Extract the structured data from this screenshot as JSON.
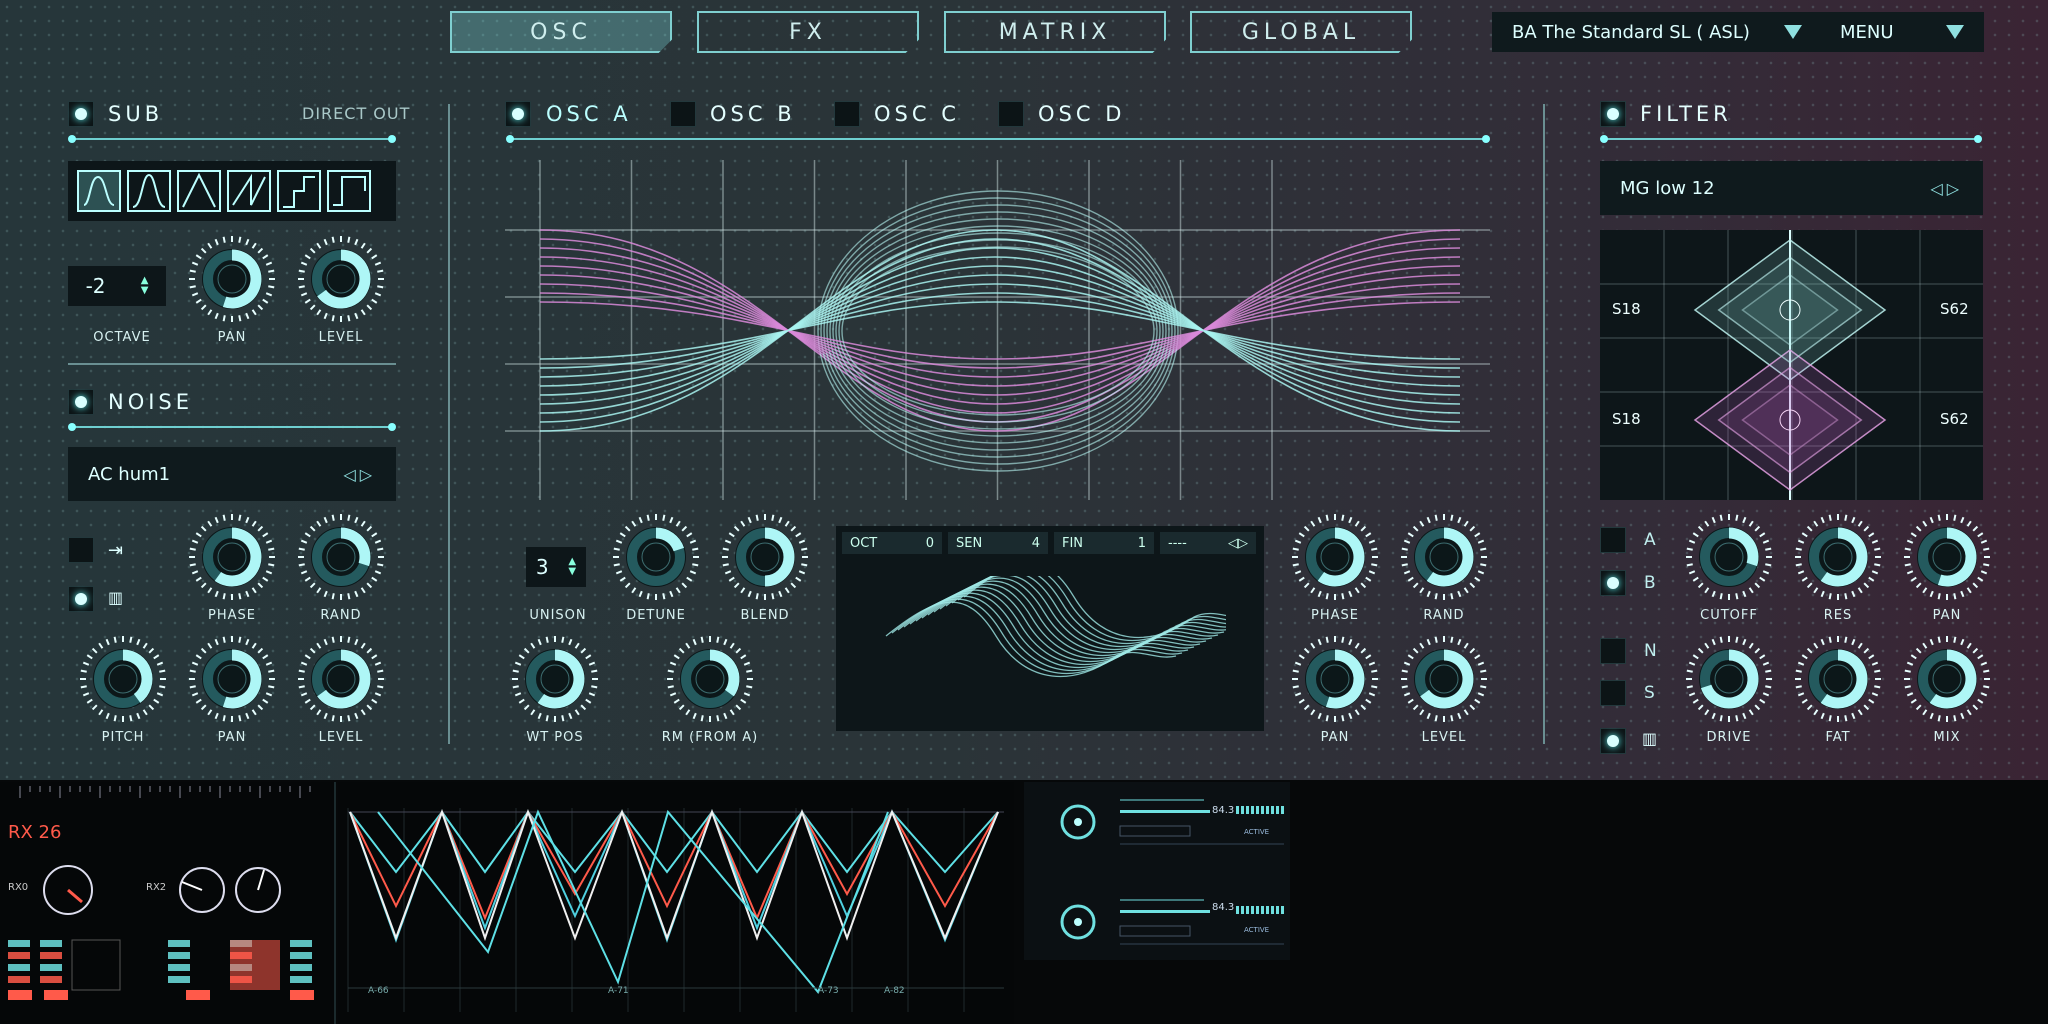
{
  "tabs": [
    {
      "label": "OSC",
      "active": true
    },
    {
      "label": "FX"
    },
    {
      "label": "MATRIX"
    },
    {
      "label": "GLOBAL"
    }
  ],
  "preset": {
    "name": "BA The Standard SL ( ASL)",
    "menu_label": "MENU"
  },
  "sub": {
    "title": "SUB",
    "direct_out": "DIRECT OUT",
    "octave_value": "-2",
    "labels": {
      "octave": "OCTAVE",
      "pan": "PAN",
      "level": "LEVEL"
    }
  },
  "noise": {
    "title": "NOISE",
    "preset": "AC hum1",
    "labels": {
      "phase": "PHASE",
      "rand": "RAND",
      "pitch": "PITCH",
      "pan": "PAN",
      "level": "LEVEL"
    }
  },
  "osc": {
    "tabs": [
      "OSC A",
      "OSC B",
      "OSC C",
      "OSC D"
    ],
    "unison_value": "3",
    "labels": {
      "unison": "UNISON",
      "detune": "DETUNE",
      "blend": "BLEND",
      "wtpos": "WT POS",
      "rm": "RM (FROM A)",
      "phase": "PHASE",
      "rand": "RAND",
      "pan": "PAN",
      "level": "LEVEL"
    },
    "wave_fields": [
      {
        "label": "OCT",
        "value": "0"
      },
      {
        "label": "SEN",
        "value": "4"
      },
      {
        "label": "FIN",
        "value": "1"
      },
      {
        "label": "----",
        "value": ""
      }
    ]
  },
  "filter": {
    "title": "FILTER",
    "type": "MG low 12",
    "s_top_left": "S18",
    "s_top_right": "S62",
    "s_bottom_left": "S18",
    "s_bottom_right": "S62",
    "routes": [
      "A",
      "B"
    ],
    "routes2": [
      "N",
      "S"
    ],
    "labels": {
      "cutoff": "CUTOFF",
      "res": "RES",
      "pan": "PAN",
      "drive": "DRIVE",
      "fat": "FAT",
      "mix": "MIX"
    }
  },
  "thumbs": {
    "t1_title": "RX 26",
    "t1_l1": "RX0",
    "t1_l2": "RX2",
    "t2_lbl1": "A-66",
    "t2_lbl2": "A-71",
    "t2_lbl3": "A-73",
    "t2_lbl4": "A-82",
    "t3_val1": "84.3",
    "t3_val2": "84.3",
    "t3_state": "ACTIVE"
  },
  "colors": {
    "accent": "#6fe0e0",
    "magenta": "#d877d8",
    "bg": "#2a3438"
  }
}
